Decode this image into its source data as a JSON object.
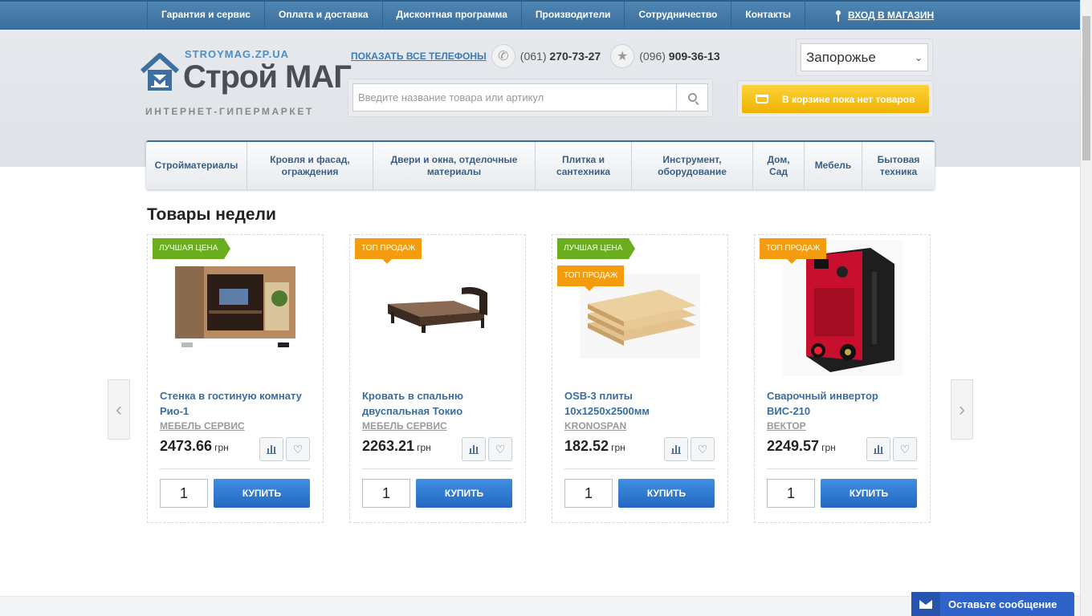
{
  "topnav": {
    "items": [
      "Гарантия и сервис",
      "Оплата и доставка",
      "Дисконтная программа",
      "Производители",
      "Сотрудничество",
      "Контакты"
    ],
    "login": "ВХОД В МАГАЗИН"
  },
  "logo": {
    "site": "STROYMAG.ZP.UA",
    "name": "Строй МАГ",
    "tagline": "ИНТЕРНЕТ-ГИПЕРМАРКЕТ"
  },
  "phones": {
    "show_all": "ПОКАЗАТЬ ВСЕ ТЕЛЕФОНЫ",
    "phone1_code": "(061)",
    "phone1_num": "270-73-27",
    "phone2_code": "(096)",
    "phone2_num": "909-36-13"
  },
  "city": {
    "selected": "Запорожье"
  },
  "search": {
    "placeholder": "Введите название товара или артикул"
  },
  "cart": {
    "label": "В корзине пока нет товаров"
  },
  "categories": [
    "Стройматериалы",
    "Кровля и фасад, ограждения",
    "Двери и окна, отделочные материалы",
    "Плитка и сантехника",
    "Инструмент, оборудование",
    "Дом, Сад",
    "Мебель",
    "Бытовая техника"
  ],
  "section_title": "Товары недели",
  "products": [
    {
      "badges": [
        "ЛУЧШАЯ ЦЕНА"
      ],
      "name": "Стенка в гостиную комнату Рио-1",
      "brand": "МЕБЕЛЬ СЕРВИС",
      "price": "2473.66",
      "currency": "грн",
      "qty": "1",
      "buy": "КУПИТЬ"
    },
    {
      "badges": [
        "ТОП ПРОДАЖ"
      ],
      "name": "Кровать в спальню двуспальная Токио",
      "brand": "МЕБЕЛЬ СЕРВИС",
      "price": "2263.21",
      "currency": "грн",
      "qty": "1",
      "buy": "КУПИТЬ"
    },
    {
      "badges": [
        "ЛУЧШАЯ ЦЕНА",
        "ТОП ПРОДАЖ"
      ],
      "name": "OSB-3 плиты 10x1250x2500мм",
      "brand": "KRONOSPAN",
      "price": "182.52",
      "currency": "грн",
      "qty": "1",
      "buy": "КУПИТЬ"
    },
    {
      "badges": [
        "ТОП ПРОДАЖ"
      ],
      "name": "Сварочный инвертор ВИС-210",
      "brand": "ВЕКТОР",
      "price": "2249.57",
      "currency": "грн",
      "qty": "1",
      "buy": "КУПИТЬ"
    }
  ],
  "chat": {
    "label": "Оставьте сообщение"
  },
  "colors": {
    "topbar": "#3f77a6",
    "cart": "#f5c01c",
    "buy": "#2f78d2",
    "badge_green": "#6aad1e",
    "badge_orange": "#f49c10",
    "chat": "#2f63c9"
  }
}
